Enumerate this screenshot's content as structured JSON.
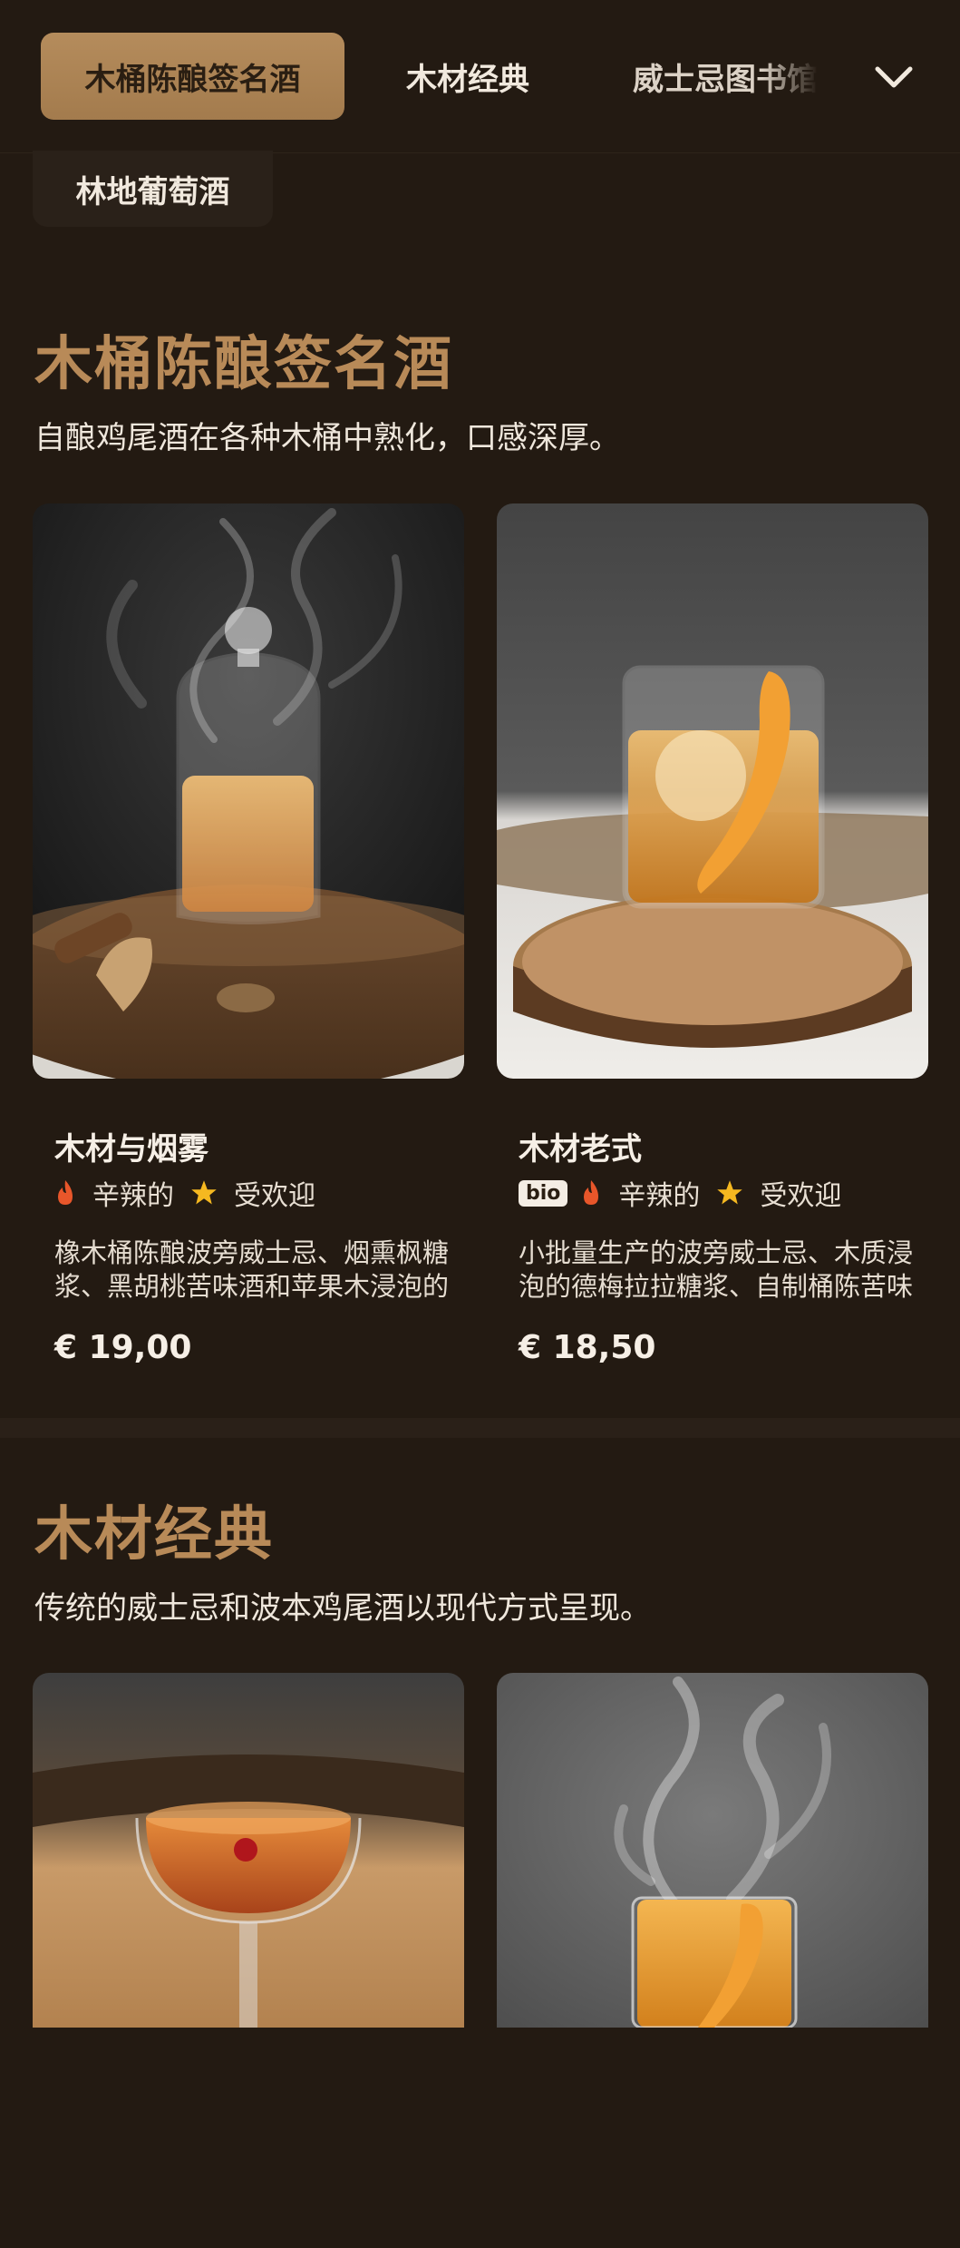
{
  "tabs": [
    {
      "label": "木桶陈酿签名酒"
    },
    {
      "label": "木材经典"
    },
    {
      "label": "威士忌图书馆"
    }
  ],
  "chip": {
    "label": "林地葡萄酒"
  },
  "sections": [
    {
      "title": "木桶陈酿签名酒",
      "description": "自酿鸡尾酒在各种木桶中熟化，口感深厚。",
      "products": [
        {
          "name": "木材与烟雾",
          "tags": [
            "辛辣的",
            "受欢迎"
          ],
          "description": "橡木桶陈酿波旁威士忌、烟熏枫糖浆、黑胡桃苦味酒和苹果木浸泡的德梅拉拉糖浆",
          "price": "€ 19,00"
        },
        {
          "name": "木材老式",
          "badge": "bio",
          "tags": [
            "辛辣的",
            "受欢迎"
          ],
          "description": "小批量生产的波旁威士忌、木质浸泡的德梅拉拉糖浆、自制桶陈苦味酒",
          "price": "€ 18,50"
        }
      ]
    },
    {
      "title": "木材经典",
      "description": "传统的威士忌和波本鸡尾酒以现代方式呈现。"
    }
  ],
  "icons": {
    "fire": "fire-icon",
    "star": "star-icon",
    "chevron": "chevron-down-icon"
  },
  "colors": {
    "background": "#231a12",
    "accent": "#b88a58",
    "active_tab": "#b58c5c",
    "fire": "#e8562a",
    "star": "#f5b820"
  }
}
